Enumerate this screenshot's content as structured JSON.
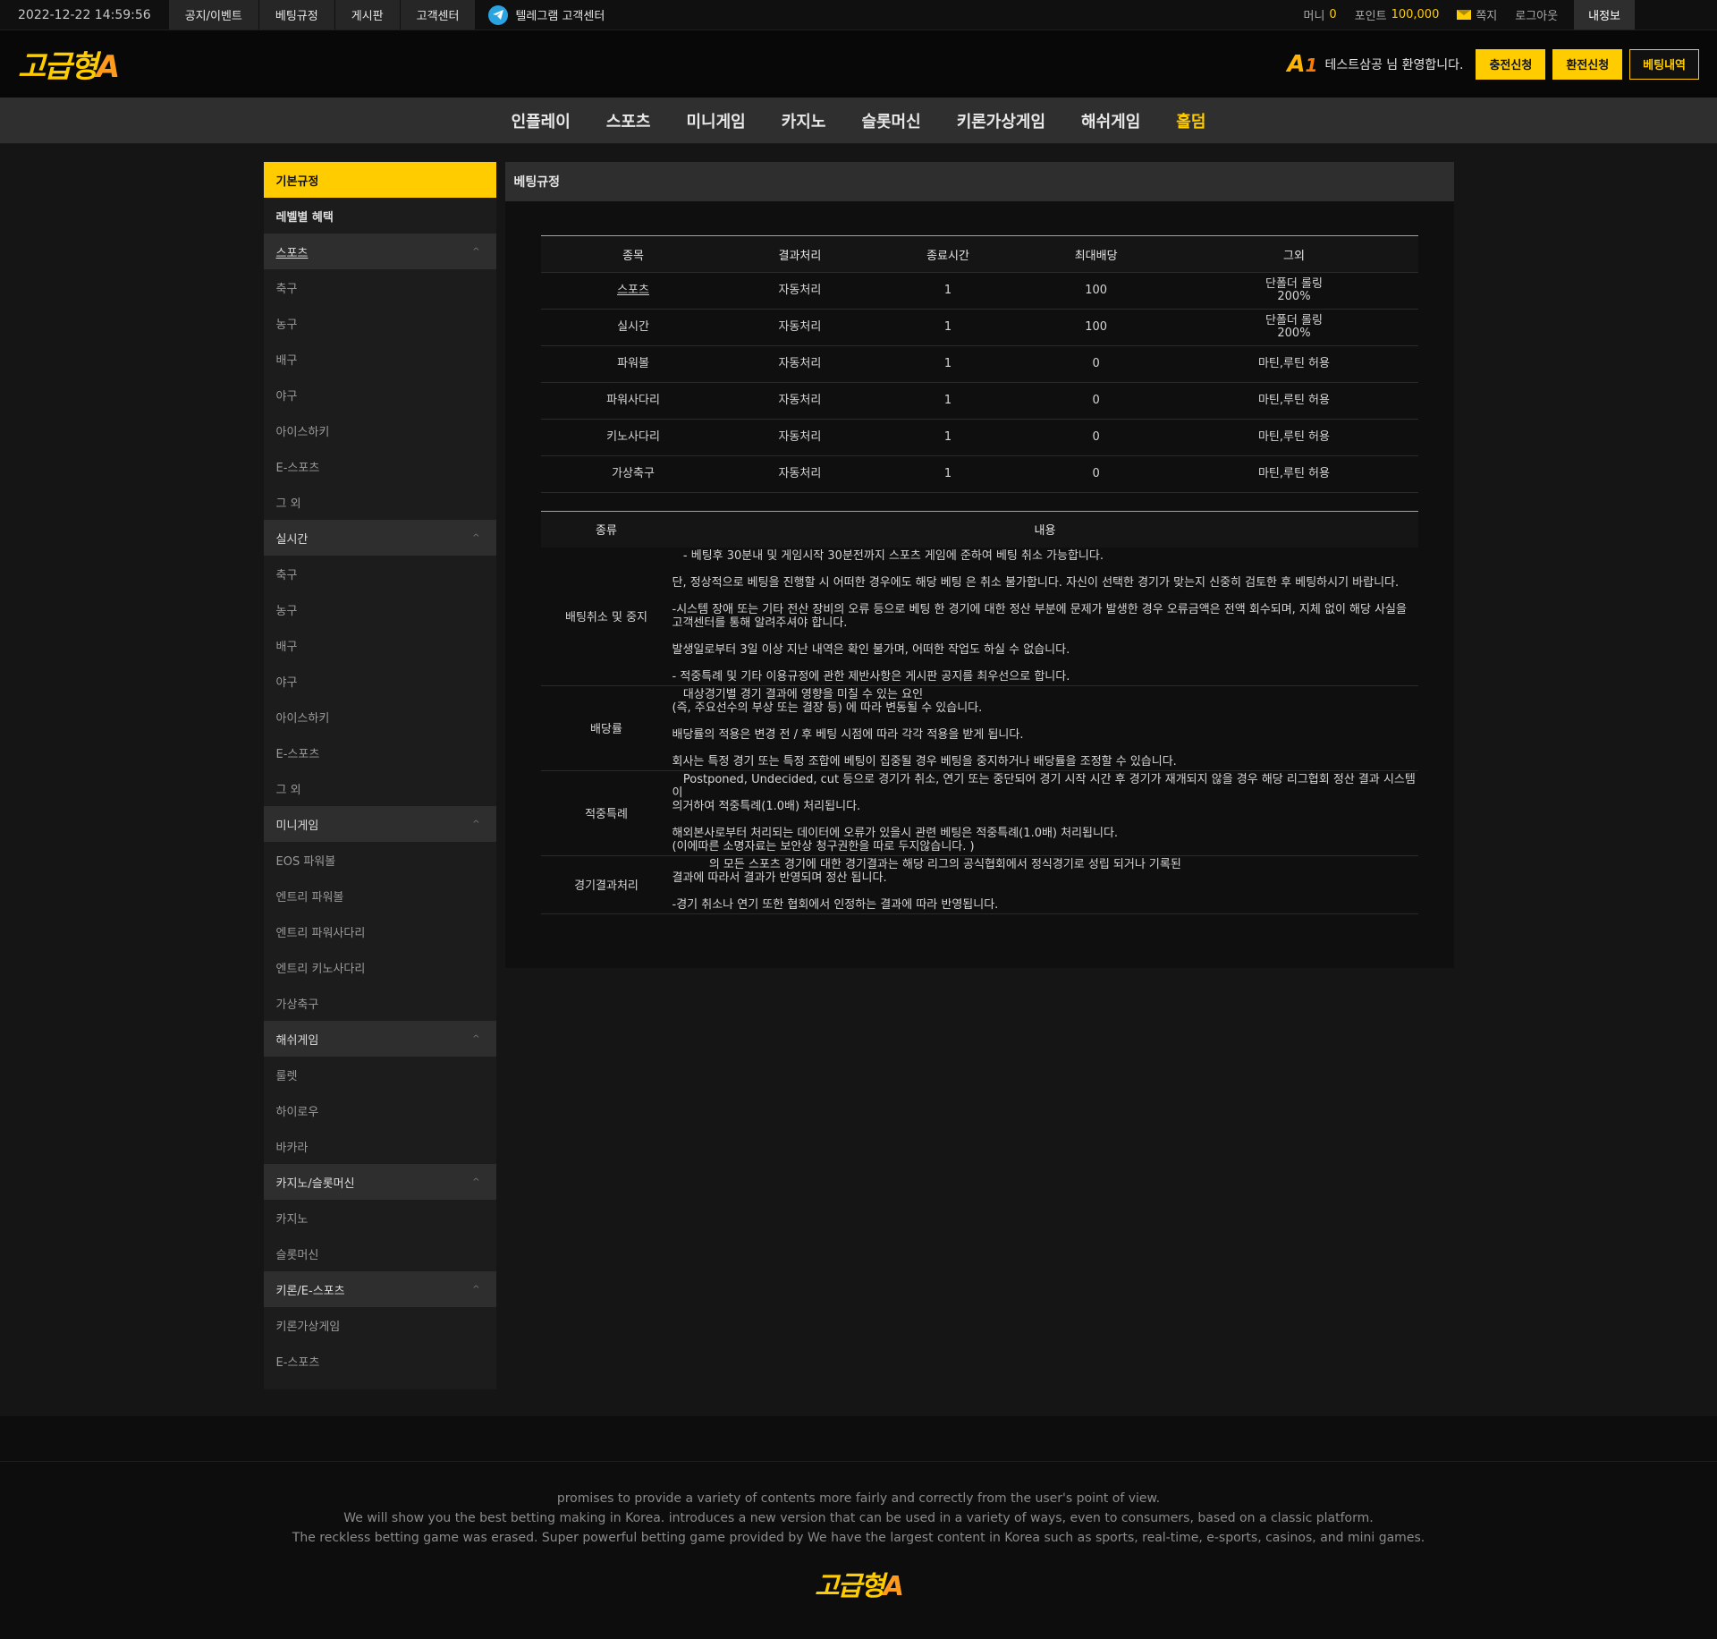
{
  "topbar": {
    "datetime": "2022-12-22 14:59:56",
    "links": [
      "공지/이벤트",
      "베팅규정",
      "게시판",
      "고객센터"
    ],
    "telegram": "텔레그램 고객센터",
    "money_label": "머니",
    "money_value": "0",
    "point_label": "포인트",
    "point_value": "100,000",
    "message": "쪽지",
    "logout": "로그아웃",
    "myinfo": "내정보"
  },
  "header": {
    "logo_text": "고급형",
    "logo_accent": "A",
    "badge_main": "A",
    "badge_num": "1",
    "welcome": "테스트삼공 님 환영합니다.",
    "deposit": "충전신청",
    "withdraw": "환전신청",
    "bet_history": "베팅내역"
  },
  "nav": [
    "인플레이",
    "스포츠",
    "미니게임",
    "카지노",
    "슬롯머신",
    "키론가상게임",
    "해쉬게임",
    "홀덤"
  ],
  "sidebar": {
    "basic": "기본규정",
    "level": "레벨별 혜택",
    "groups": [
      {
        "title": "스포츠",
        "items": [
          "축구",
          "농구",
          "배구",
          "야구",
          "아이스하키",
          "E-스포츠",
          "그 외"
        ]
      },
      {
        "title": "실시간",
        "items": [
          "축구",
          "농구",
          "배구",
          "야구",
          "아이스하키",
          "E-스포츠",
          "그 외"
        ]
      },
      {
        "title": "미니게임",
        "items": [
          "EOS 파워볼",
          "엔트리 파워볼",
          "엔트리 파워사다리",
          "엔트리 키노사다리",
          "가상축구"
        ]
      },
      {
        "title": "해쉬게임",
        "items": [
          "룰렛",
          "하이로우",
          "바카라"
        ]
      },
      {
        "title": "카지노/슬롯머신",
        "items": [
          "카지노",
          "슬롯머신"
        ]
      },
      {
        "title": "키론/E-스포츠",
        "items": [
          "키론가상게임",
          "E-스포츠"
        ]
      }
    ]
  },
  "content": {
    "title": "베팅규정",
    "table1": {
      "headers": [
        "종목",
        "결과처리",
        "종료시간",
        "최대배당",
        "그외"
      ],
      "rows": [
        [
          "스포츠",
          "자동처리",
          "1",
          "100",
          "단폴더 롤링\n200%"
        ],
        [
          "실시간",
          "자동처리",
          "1",
          "100",
          "단폴더 롤링\n200%"
        ],
        [
          "파워볼",
          "자동처리",
          "1",
          "0",
          "마틴,루틴 허용"
        ],
        [
          "파워사다리",
          "자동처리",
          "1",
          "0",
          "마틴,루틴 허용"
        ],
        [
          "키노사다리",
          "자동처리",
          "1",
          "0",
          "마틴,루틴 허용"
        ],
        [
          "가상축구",
          "자동처리",
          "1",
          "0",
          "마틴,루틴 허용"
        ]
      ]
    },
    "table2": {
      "headers": [
        "종류",
        "내용"
      ],
      "rows": [
        {
          "kind": "배팅취소 및 중지",
          "text": "   - 베팅후 30분내 및 게임시작 30분전까지 스포츠 게임에 준하여 베팅 취소 가능합니다.\n\n단, 정상적으로 베팅을 진행할 시 어떠한 경우에도 해당 베팅 은 취소 불가합니다. 자신이 선택한 경기가 맞는지 신중히 검토한 후 베팅하시기 바랍니다.\n\n-시스템 장애 또는 기타 전산 장비의 오류 등으로 베팅 한 경기에 대한 정산 부분에 문제가 발생한 경우 오류금액은 전액 회수되며, 지체 없이 해당 사실을\n고객센터를 통해 알려주셔야 합니다.\n\n발생일로부터 3일 이상 지난 내역은 확인 불가며, 어떠한 작업도 하실 수 없습니다.\n\n- 적중특례 및 기타 이용규정에 관한 제반사항은 게시판 공지를 최우선으로 합니다."
        },
        {
          "kind": "배당률",
          "text": "   대상경기별 경기 결과에 영향을 미칠 수 있는 요인\n(즉, 주요선수의 부상 또는 결장 등) 에 따라 변동될 수 있습니다.\n\n배당률의 적용은 변경 전 / 후 베팅 시점에 따라 각각 적용을 받게 됩니다.\n\n회사는 특정 경기 또는 특정 조합에 베팅이 집중될 경우 베팅을 중지하거나 배당률을 조정할 수 있습니다."
        },
        {
          "kind": "적중특례",
          "text": "   Postponed, Undecided, cut 등으로 경기가 취소, 연기 또는 중단되어 경기 시작 시간 후 경기가 재개되지 않을 경우 해당 리그협회 정산 결과 시스템이\n의거하여 적중특례(1.0배) 처리됩니다.\n\n해외본사로부터 처리되는 데이터에 오류가 있을시 관련 베팅은 적중특례(1.0배) 처리됩니다.\n(이에따른 소명자료는 보안상 청구권한을 따로 두지않습니다. )"
        },
        {
          "kind": "경기결과처리",
          "text": "          의 모든 스포츠 경기에 대한 경기결과는 해당 리그의 공식협회에서 정식경기로 성립 되거나 기록된\n결과에 따라서 결과가 반영되며 정산 됩니다.\n\n-경기 취소나 연기 또한 협회에서 인정하는 결과에 따라 반영됩니다."
        }
      ]
    }
  },
  "footer": {
    "lines": [
      "promises to provide a variety of contents more fairly and correctly from the user's point of view.",
      "We will show you the best betting making in Korea. introduces a new version that can be used in a variety of ways, even to consumers, based on a classic platform.",
      "The reckless betting game was erased. Super powerful betting game provided by  We have the largest content in Korea such as sports, real-time, e-sports, casinos, and mini games."
    ]
  },
  "colors": {
    "accent": "#ffcc00",
    "telegram": "#2aa3e0",
    "table_line": "#c9a245"
  }
}
